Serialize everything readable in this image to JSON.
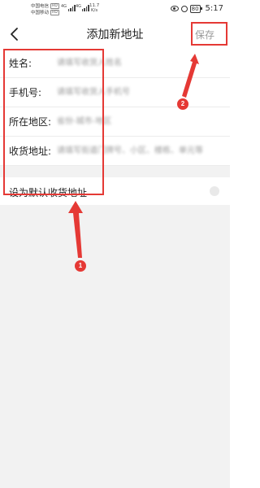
{
  "status_bar": {
    "carrier_1": "中国电信",
    "carrier_2": "中国移动",
    "hd_badge": "HD",
    "signal_label": "4G",
    "net_speed_value": "11.7",
    "net_speed_unit": "K/s",
    "battery": "80",
    "time": "5:17"
  },
  "header": {
    "title": "添加新地址",
    "save_label": "保存",
    "back_icon": "chevron-left-icon"
  },
  "form": {
    "fields": [
      {
        "label": "姓名:",
        "placeholder": "请填写收货人姓名"
      },
      {
        "label": "手机号:",
        "placeholder": "请填写收货人手机号"
      },
      {
        "label": "所在地区:",
        "placeholder": "省份-城市-地区"
      },
      {
        "label": "收货地址:",
        "placeholder": "请填写街道门牌号、小区、楼栋、单元等"
      }
    ],
    "default_label": "设为默认收货地址",
    "default_on": false
  },
  "annotations": {
    "badge_1": "1",
    "badge_2": "2",
    "color": "#e53935"
  }
}
